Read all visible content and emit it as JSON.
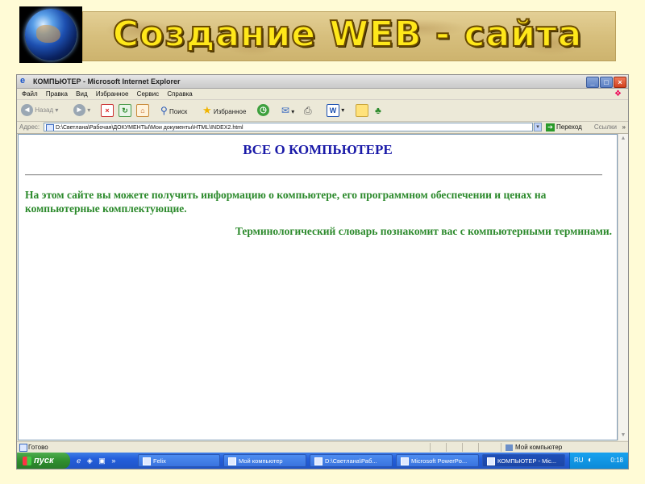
{
  "slide": {
    "title": "Создание WEB - сайта"
  },
  "window": {
    "title": "КОМПЬЮТЕР - Microsoft Internet Explorer",
    "min_label": "_",
    "max_label": "□",
    "close_label": "×"
  },
  "menu": {
    "items": [
      "Файл",
      "Правка",
      "Вид",
      "Избранное",
      "Сервис",
      "Справка"
    ]
  },
  "toolbar": {
    "back_label": "Назад",
    "search_label": "Поиск",
    "favorites_label": "Избранное"
  },
  "address": {
    "label": "Адрес:",
    "value": "D:\\Светлана\\Рабочая\\ДОКУМЕНТЫ\\Мои документы\\HTML\\INDEX2.html",
    "go_label": "Переход",
    "links_label": "Ссылки"
  },
  "page": {
    "heading": "ВСЕ О КОМПЬЮТЕРЕ",
    "paragraph1": "На этом сайте вы можете получить информацию о компьютере, его программном обеспечении и ценах на компьютерные комплектующие.",
    "paragraph2": "Терминологический словарь познакомит вас с компьютерными терминами."
  },
  "status": {
    "text": "Готово",
    "zone": "Мой компьютер"
  },
  "taskbar": {
    "start_label": "пуск",
    "tasks": [
      {
        "label": "Felix",
        "active": false
      },
      {
        "label": "Мой компьютер",
        "active": false
      },
      {
        "label": "D:\\Светлана\\Раб...",
        "active": false
      },
      {
        "label": "Microsoft PowerPo...",
        "active": false
      },
      {
        "label": "КОМПЬЮТЕР - Mic...",
        "active": true
      }
    ],
    "lang": "RU",
    "clock": "0:18"
  },
  "colors": {
    "heading": "#1a1aa8",
    "text_green": "#2c8a2c",
    "slide_title": "#ffe81a"
  }
}
